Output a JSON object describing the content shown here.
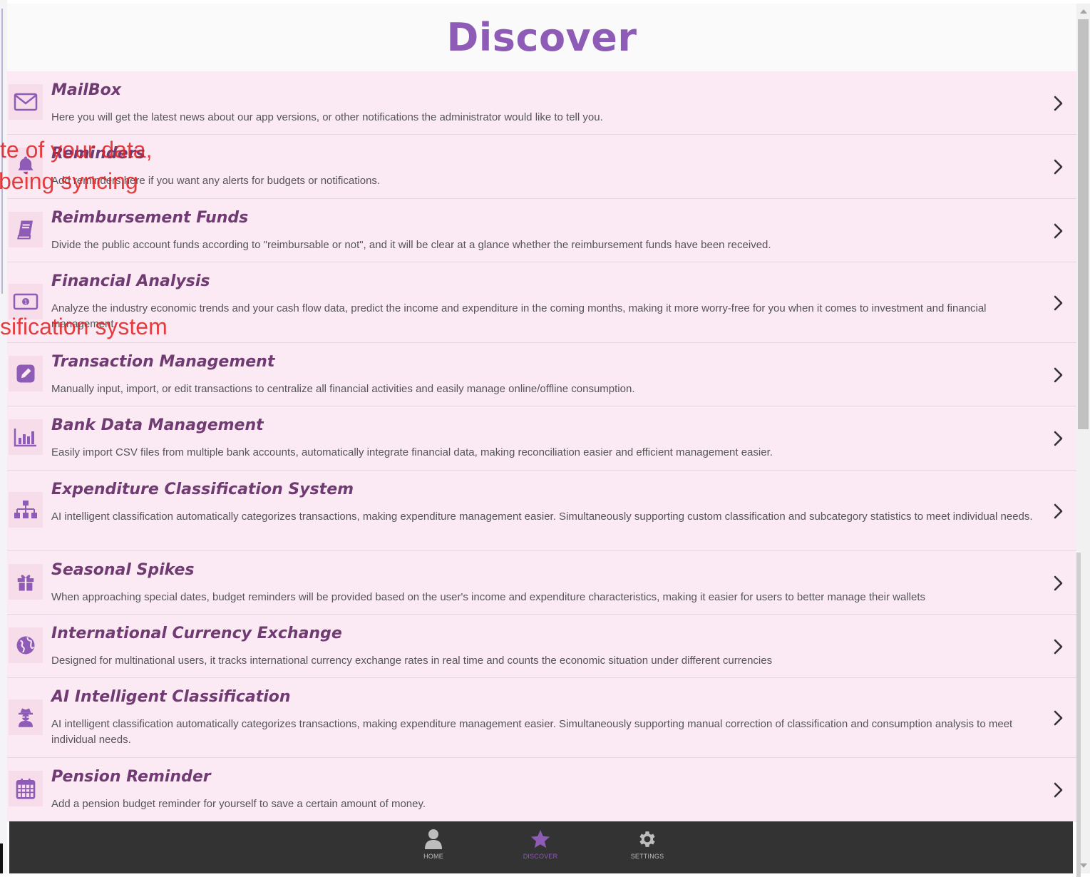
{
  "page": {
    "title": "Discover",
    "accent_color": "#8e5bb7",
    "row_color": "#fbe9f3",
    "title_color": "#6f3b72"
  },
  "items": [
    {
      "title": "MailBox",
      "icon": "envelope-icon",
      "description": "Here you will get the latest news about our app versions, or other notifications the administrator would like to tell you."
    },
    {
      "title": "Reminders",
      "icon": "bell-icon",
      "description": "Add reminders here if you want any alerts for budgets or notifications."
    },
    {
      "title": "Reimbursement Funds",
      "icon": "book-icon",
      "description": "Divide the public account funds according to \"reimbursable or not\", and it will be clear at a glance whether the reimbursement funds have been received."
    },
    {
      "title": "Financial Analysis",
      "icon": "money-bill-icon",
      "description": "Analyze the industry economic trends and your cash flow data, predict the income and expenditure in the coming months, making it more worry-free for you when it comes to investment and financial management."
    },
    {
      "title": "Transaction Management",
      "icon": "edit-icon",
      "description": "Manually input, import, or edit transactions to centralize all financial activities and easily manage online/offline consumption."
    },
    {
      "title": "Bank Data Management",
      "icon": "bar-chart-icon",
      "description": "Easily import CSV files from multiple bank accounts, automatically integrate financial data, making reconciliation easier and efficient management easier."
    },
    {
      "title": "Expenditure Classification System",
      "icon": "sitemap-icon",
      "description": "AI intelligent classification automatically categorizes transactions, making expenditure management easier. Simultaneously supporting custom classification and subcategory statistics to meet individual needs."
    },
    {
      "title": "Seasonal Spikes",
      "icon": "gift-icon",
      "description": "When approaching special dates, budget reminders will be provided based on the user's income and expenditure characteristics, making it easier for users to better manage their wallets"
    },
    {
      "title": "International Currency Exchange",
      "icon": "globe-icon",
      "description": "Designed for multinational users, it tracks international currency exchange rates in real time and counts the economic situation under different currencies"
    },
    {
      "title": "AI Intelligent Classification",
      "icon": "user-secret-icon",
      "description": "AI intelligent classification automatically categorizes transactions, making expenditure management easier. Simultaneously supporting manual correction of classification and consumption analysis to meet individual needs."
    },
    {
      "title": "Pension Reminder",
      "icon": "calendar-icon",
      "description": "Add a pension budget reminder for yourself to save a certain amount of money."
    }
  ],
  "tabbar": {
    "home_label": "HOME",
    "discover_label": "DISCOVER",
    "settings_label": "SETTINGS",
    "active": "discover"
  },
  "overlay": {
    "line1": "te of your data,",
    "line2": "being syncing",
    "line3": "sification system"
  }
}
